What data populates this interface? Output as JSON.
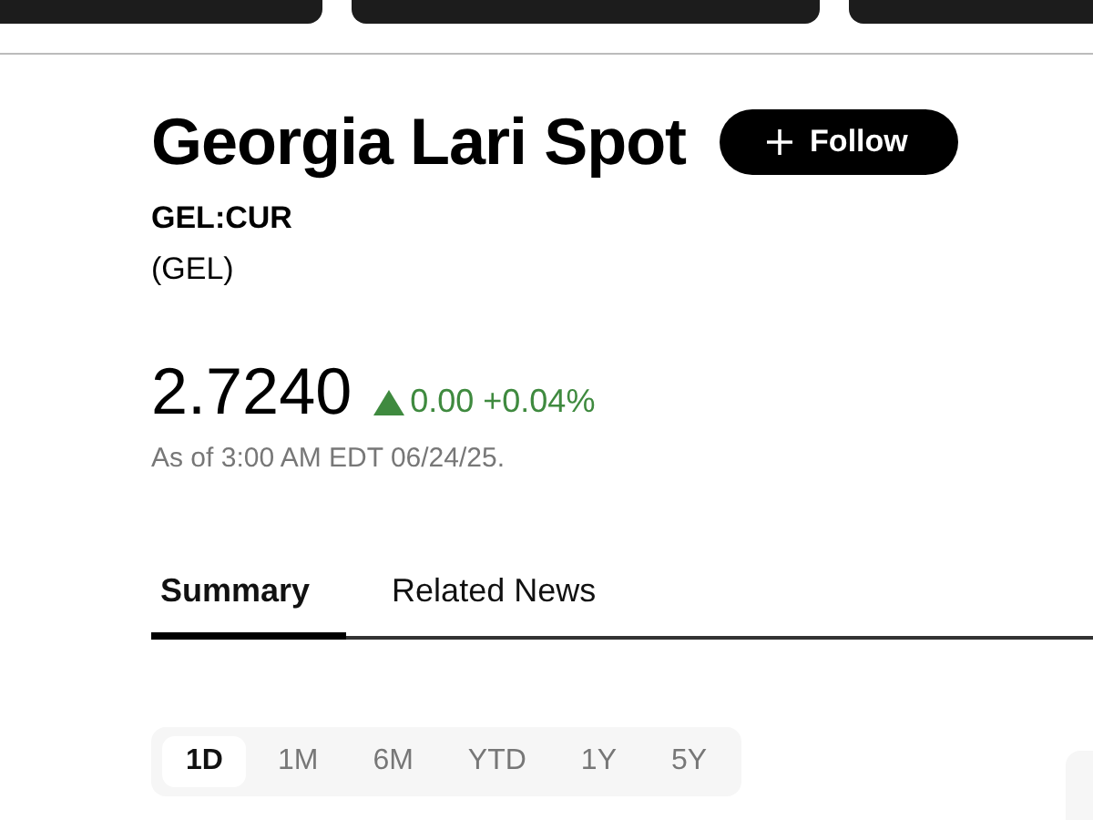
{
  "quote": {
    "title": "Georgia Lari Spot",
    "follow_label": "Follow",
    "ticker": "GEL:CUR",
    "currency": "(GEL)",
    "price": "2.7240",
    "rising": true,
    "change": "0.00",
    "change_percent": "+0.04%",
    "as_of": "As of 3:00 AM EDT 06/24/25."
  },
  "tabs": [
    {
      "label": "Summary",
      "selected": true
    },
    {
      "label": "Related News",
      "selected": false
    }
  ],
  "ranges": [
    {
      "label": "1D",
      "selected": true
    },
    {
      "label": "1M",
      "selected": false
    },
    {
      "label": "6M",
      "selected": false
    },
    {
      "label": "YTD",
      "selected": false
    },
    {
      "label": "1Y",
      "selected": false
    },
    {
      "label": "5Y",
      "selected": false
    }
  ]
}
